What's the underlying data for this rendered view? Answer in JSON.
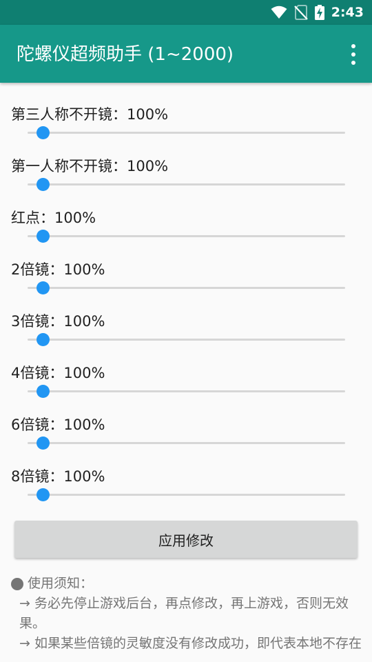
{
  "status_bar": {
    "time": "2:43",
    "background": "#0f7f71",
    "icons": [
      "wifi-icon",
      "no-sim-icon",
      "battery-charging-icon"
    ]
  },
  "app_bar": {
    "title": "陀螺仪超频助手 (1~2000)",
    "background": "#169889",
    "menu_icon": "overflow-menu-icon"
  },
  "sliders": [
    {
      "label": "第三人称不开镜：",
      "value": "100%"
    },
    {
      "label": "第一人称不开镜：",
      "value": "100%"
    },
    {
      "label": "红点：",
      "value": "100%"
    },
    {
      "label": "2倍镜：",
      "value": "100%"
    },
    {
      "label": "3倍镜：",
      "value": "100%"
    },
    {
      "label": "4倍镜：",
      "value": "100%"
    },
    {
      "label": "6倍镜：",
      "value": "100%"
    },
    {
      "label": "8倍镜：",
      "value": "100%"
    }
  ],
  "accent": "#2196f3",
  "apply_button": {
    "label": "应用修改"
  },
  "notice": {
    "title": "使用须知：",
    "items": [
      "→ 务必先停止游戏后台，再点修改，再上游戏，否则无效果。",
      "→ 如果某些倍镜的灵敏度没有修改成功，即代表本地不存在该倍镜的灵敏度配置信息(游戏默认值)，需要先"
    ]
  }
}
